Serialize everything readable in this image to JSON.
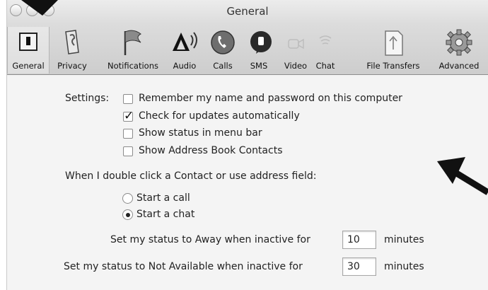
{
  "window": {
    "title": "General"
  },
  "toolbar": {
    "items": [
      {
        "label": "General",
        "icon": "general-switch-icon"
      },
      {
        "label": "Privacy",
        "icon": "privacy-icon"
      },
      {
        "label": "Notifications",
        "icon": "flag-icon"
      },
      {
        "label": "Audio",
        "icon": "speaker-icon"
      },
      {
        "label": "Calls",
        "icon": "phone-icon"
      },
      {
        "label": "SMS",
        "icon": "sms-icon"
      },
      {
        "label": "Video",
        "icon": "video-icon"
      },
      {
        "label": "Chat",
        "icon": "chat-icon"
      },
      {
        "label": "File Transfers",
        "icon": "file-transfer-icon"
      },
      {
        "label": "Advanced",
        "icon": "gear-icon"
      }
    ],
    "selected": "General"
  },
  "settings": {
    "label": "Settings:",
    "options": [
      {
        "label": "Remember my name and password on this computer",
        "checked": false
      },
      {
        "label": "Check for updates automatically",
        "checked": true
      },
      {
        "label": "Show status in menu bar",
        "checked": false
      },
      {
        "label": "Show Address Book Contacts",
        "checked": false
      }
    ]
  },
  "double_click": {
    "label": "When I double click a Contact or use address field:",
    "options": [
      {
        "label": "Start a call",
        "selected": false
      },
      {
        "label": "Start a chat",
        "selected": true
      }
    ]
  },
  "away": {
    "label": "Set my status to Away when inactive for",
    "value": "10",
    "unit": "minutes"
  },
  "not_available": {
    "label": "Set my status to Not Available when inactive for",
    "value": "30",
    "unit": "minutes"
  }
}
